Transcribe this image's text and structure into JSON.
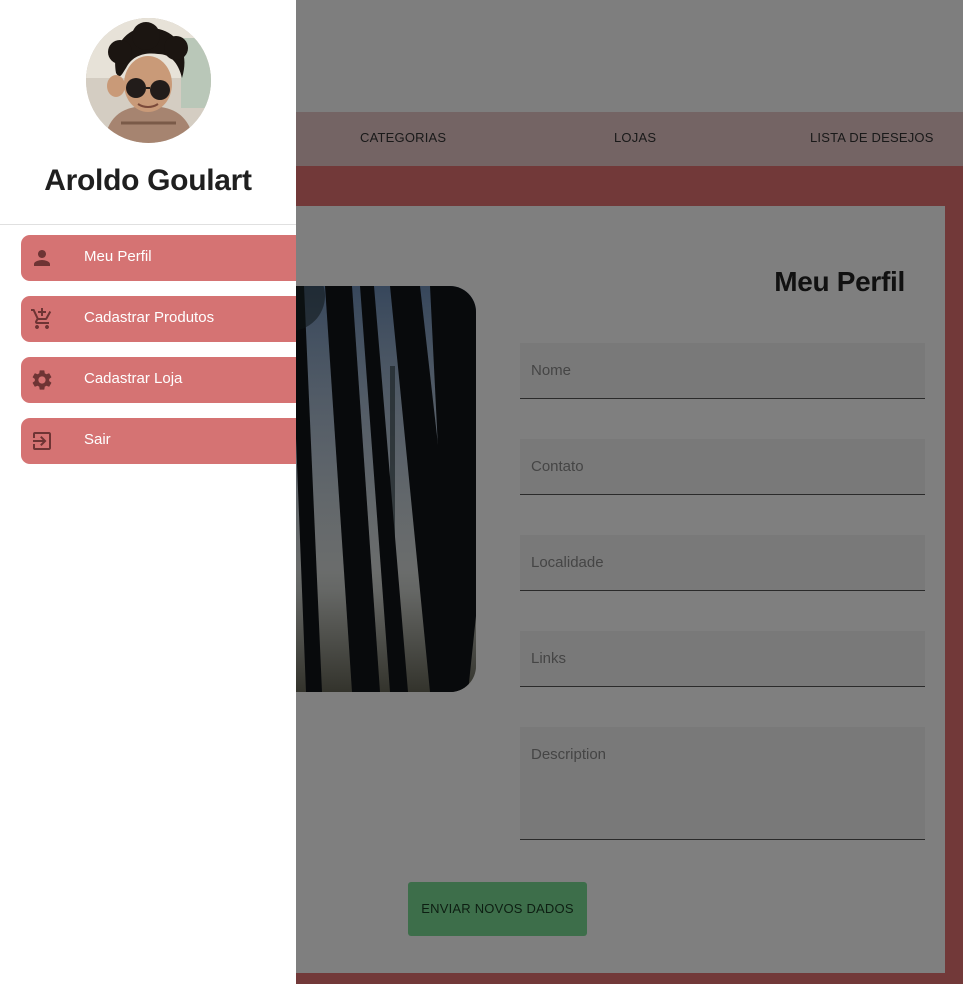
{
  "nav": {
    "links": [
      "CATEGORIAS",
      "LOJAS",
      "LISTA DE DESEJOS"
    ]
  },
  "main": {
    "title": "Meu Perfil",
    "fields": [
      {
        "placeholder": "Nome"
      },
      {
        "placeholder": "Contato"
      },
      {
        "placeholder": "Localidade"
      },
      {
        "placeholder": "Links"
      },
      {
        "placeholder": "Description"
      }
    ],
    "submit_label": "ENVIAR NOVOS DADOS"
  },
  "drawer": {
    "user_name": "Aroldo Goulart",
    "items": [
      {
        "label": "Meu Perfil",
        "icon": "person-icon"
      },
      {
        "label": "Cadastrar Produtos",
        "icon": "add-shopping-cart-icon"
      },
      {
        "label": "Cadastrar Loja",
        "icon": "gear-icon"
      },
      {
        "label": "Sair",
        "icon": "logout-icon"
      }
    ]
  },
  "colors": {
    "accent": "#e57373",
    "menu_item": "#d57373",
    "nav_bar": "#e8c9c9",
    "submit": "#7bdc95",
    "scrim": "rgba(0,0,0,0.5)"
  }
}
